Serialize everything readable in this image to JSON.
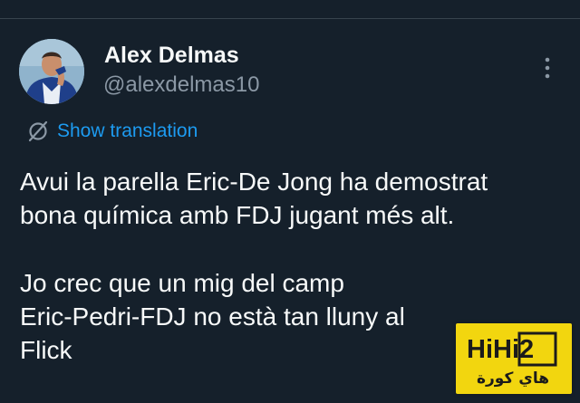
{
  "author": {
    "display_name": "Alex Delmas",
    "handle": "@alexdelmas10",
    "avatar_icon": "person-photo"
  },
  "menu": {
    "icon": "more-vertical-icon"
  },
  "translation": {
    "label": "Show translation",
    "icon": "globe-slash-icon"
  },
  "tweet": {
    "lines": [
      "Avui la parella Eric-De Jong ha demostrat",
      "bona química amb FDJ jugant més alt.",
      "",
      "Jo crec que un mig del camp",
      "Eric-Pedri-FDJ no està tan lluny al",
      "Flick"
    ]
  },
  "watermark": {
    "logo_text": "HiHi2",
    "arabic_text": "هاي كورة"
  },
  "colors": {
    "background": "#15202b",
    "text_primary": "#f7f9f9",
    "text_secondary": "#8b98a5",
    "link": "#1d9bf0",
    "watermark_bg": "#f2d60f"
  }
}
